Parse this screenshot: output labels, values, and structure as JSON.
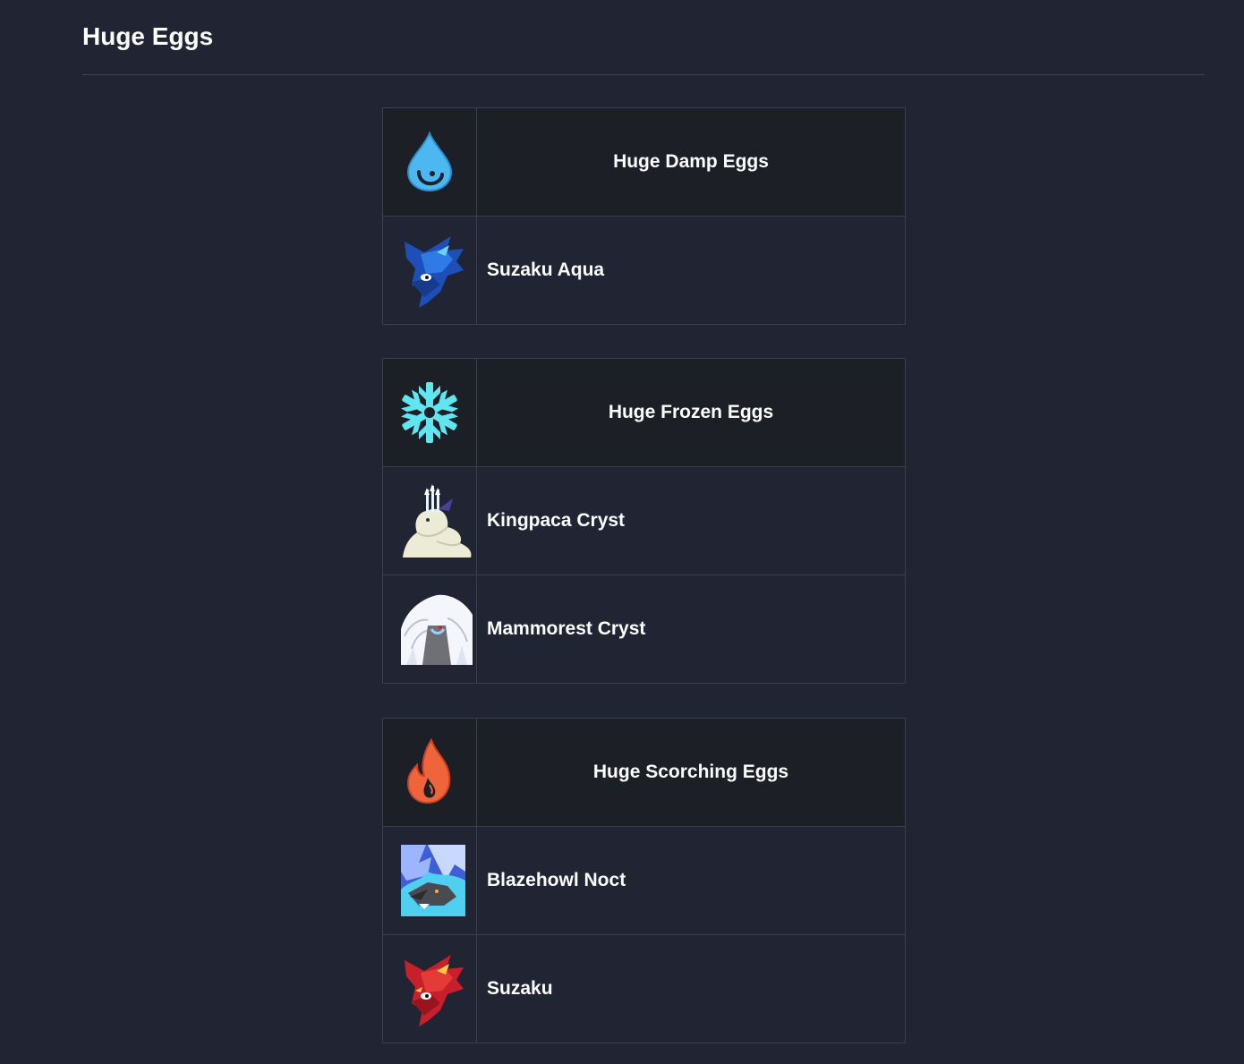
{
  "page": {
    "title": "Huge Eggs"
  },
  "groups": [
    {
      "title": "Huge Damp Eggs",
      "element_icon": "water-drop-icon",
      "color": "#4db8f0",
      "pals": [
        {
          "name": "Suzaku Aqua",
          "icon": "suzaku-aqua-portrait"
        }
      ]
    },
    {
      "title": "Huge Frozen Eggs",
      "element_icon": "snowflake-icon",
      "color": "#5fe6f0",
      "pals": [
        {
          "name": "Kingpaca Cryst",
          "icon": "kingpaca-cryst-portrait"
        },
        {
          "name": "Mammorest Cryst",
          "icon": "mammorest-cryst-portrait"
        }
      ]
    },
    {
      "title": "Huge Scorching Eggs",
      "element_icon": "flame-icon",
      "color": "#f0643c",
      "pals": [
        {
          "name": "Blazehowl Noct",
          "icon": "blazehowl-noct-portrait"
        },
        {
          "name": "Suzaku",
          "icon": "suzaku-portrait"
        }
      ]
    }
  ]
}
